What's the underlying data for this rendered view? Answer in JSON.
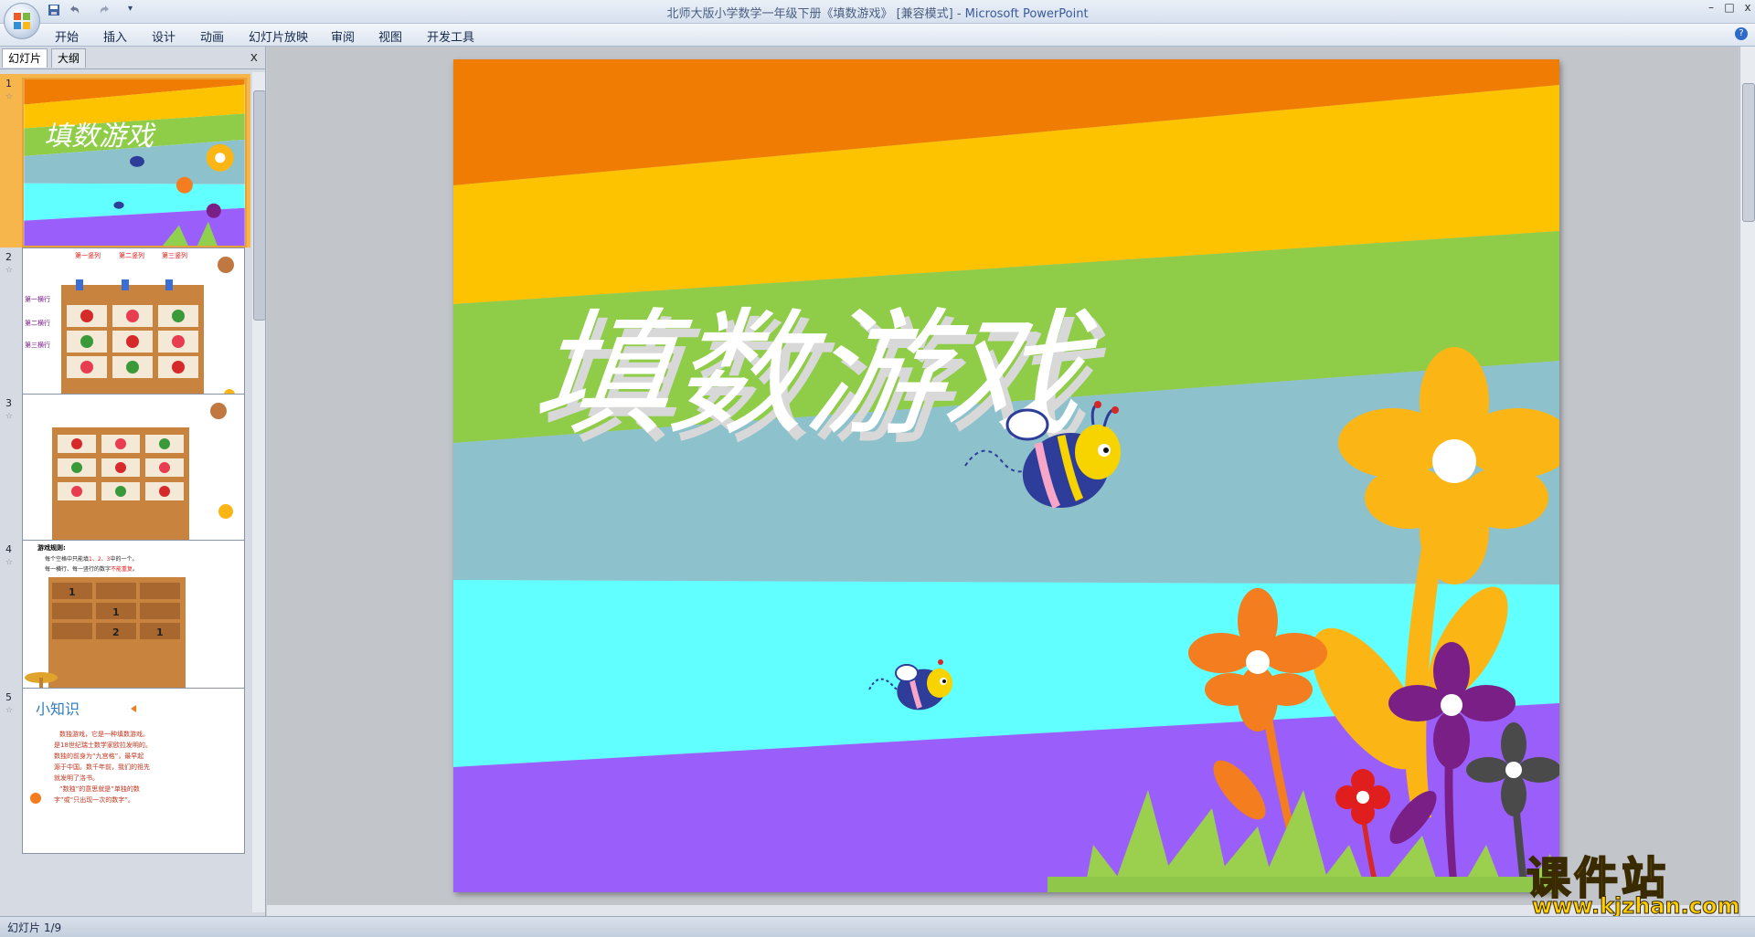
{
  "window": {
    "title_prefix": "北师大版小学数学一年级下册《填数游戏》 [兼容模式] - ",
    "app_name": "Microsoft PowerPoint",
    "minimize": "–",
    "maximize": "□",
    "close": "x"
  },
  "quick_access": {
    "save_icon": "save-icon",
    "undo_icon": "undo-icon",
    "redo_icon": "redo-icon",
    "customize": "▾"
  },
  "ribbon": {
    "tabs": [
      "开始",
      "插入",
      "设计",
      "动画",
      "幻灯片放映",
      "审阅",
      "视图",
      "开发工具"
    ],
    "help": "?"
  },
  "panel": {
    "tabs": [
      "幻灯片",
      "大纲"
    ],
    "close": "x"
  },
  "slides": [
    {
      "num": "1",
      "title": "填数游戏"
    },
    {
      "num": "2",
      "cols": [
        "第一竖列",
        "第二竖列",
        "第三竖列"
      ],
      "rows": [
        "第一横行",
        "第二横行",
        "第三横行"
      ]
    },
    {
      "num": "3"
    },
    {
      "num": "4",
      "heading": "游戏规则:",
      "rule1_a": "每个空格中只能填",
      "rule1_b": "1、2、3",
      "rule1_c": "中的一个。",
      "rule2_a": "每一横行、每一竖行的数字",
      "rule2_b": "不能重复",
      "rule2_c": "。",
      "grid": [
        "1",
        "",
        "",
        "",
        "1",
        "",
        "",
        "2",
        "1"
      ]
    },
    {
      "num": "5",
      "heading": "小知识",
      "lines": [
        "数独游戏，它是一种填数游戏。",
        "是18世纪瑞士数学家欧拉发明的。",
        "数独的前身为“九宫格”，最早起",
        "源于中国。数千年前，我们的祖先",
        "就发明了洛书。",
        "“数独”的意思就是“单独的数",
        "字”或“只出现一次的数字”。"
      ]
    }
  ],
  "main_slide": {
    "title": "填数游戏",
    "stripe_colors": [
      "#f07c04",
      "#fdc300",
      "#8fcc48",
      "#8dc2cc",
      "#61ffff",
      "#9a5ffb"
    ]
  },
  "status": {
    "slide_indicator": "幻灯片 1/9"
  },
  "watermark": {
    "big": "课件站",
    "small": "www.kjzhan.com"
  }
}
